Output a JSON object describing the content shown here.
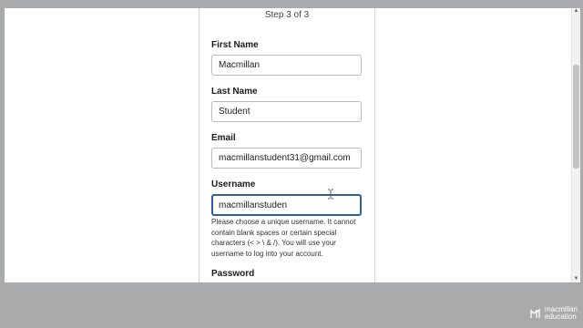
{
  "form": {
    "step_text": "Step 3 of 3",
    "fields": {
      "first_name": {
        "label": "First Name",
        "value": "Macmillan"
      },
      "last_name": {
        "label": "Last Name",
        "value": "Student"
      },
      "email": {
        "label": "Email",
        "value": "macmillanstudent31@gmail.com"
      },
      "username": {
        "label": "Username",
        "value": "macmillanstuden"
      },
      "password": {
        "label": "Password",
        "value": ""
      }
    },
    "username_hint": "Please choose a unique username. It cannot contain blank spaces or certain special characters (< > \\ & /). You will use your username to log into your account."
  },
  "branding": {
    "line1": "macmillan",
    "line2": "education"
  },
  "colors": {
    "background": "#a9aaab",
    "focus_border": "#2f5fa3"
  },
  "icons": {
    "cursor": "text-cursor-icon",
    "eye": "eye-icon",
    "brand": "macmillan-logo-icon"
  }
}
